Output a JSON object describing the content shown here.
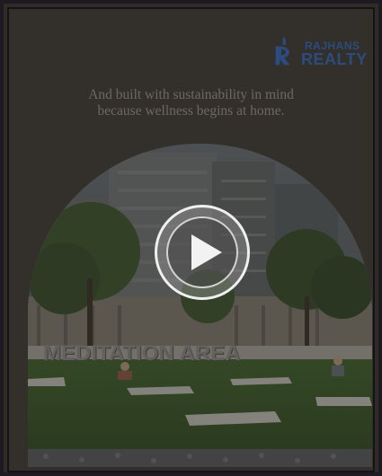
{
  "brand": {
    "name_top": "RAJHANS",
    "name_bottom": "REALTY",
    "color": "#2b4c7e"
  },
  "tagline": {
    "line1": "And built with sustainability in mind",
    "line2": "because wellness begins at home."
  },
  "video": {
    "sign_text": "MEDITATION AREA",
    "play_icon": "play-icon"
  },
  "colors": {
    "background": "#332f2a",
    "tagline": "#6f6861",
    "play_ring": "#efefef"
  }
}
